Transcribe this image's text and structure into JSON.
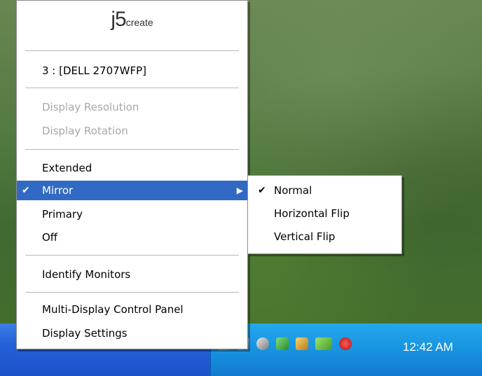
{
  "menu": {
    "logo_main": "j5",
    "logo_sub": "create",
    "monitor": "3 : [DELL 2707WFP]",
    "items": {
      "display_resolution": "Display Resolution",
      "display_rotation": "Display Rotation",
      "extended": "Extended",
      "mirror": "Mirror",
      "primary": "Primary",
      "off": "Off",
      "identify": "Identify Monitors",
      "control_panel": "Multi-Display Control Panel",
      "display_settings": "Display Settings"
    },
    "check_mark": "✔",
    "submenu_arrow": "▶"
  },
  "submenu": {
    "normal": "Normal",
    "horizontal": "Horizontal Flip",
    "vertical": "Vertical Flip"
  },
  "taskbar": {
    "time": "12:42 AM",
    "tray_icons": [
      "network-icon",
      "app-icon",
      "satellite-icon",
      "shield-icon",
      "volume-icon",
      "nvidia-icon",
      "security-alert-icon"
    ]
  },
  "colors": {
    "selection": "#316ac5",
    "disabled_text": "#a8a8a8",
    "taskbar": "#2461d8",
    "tray": "#1793e0"
  }
}
